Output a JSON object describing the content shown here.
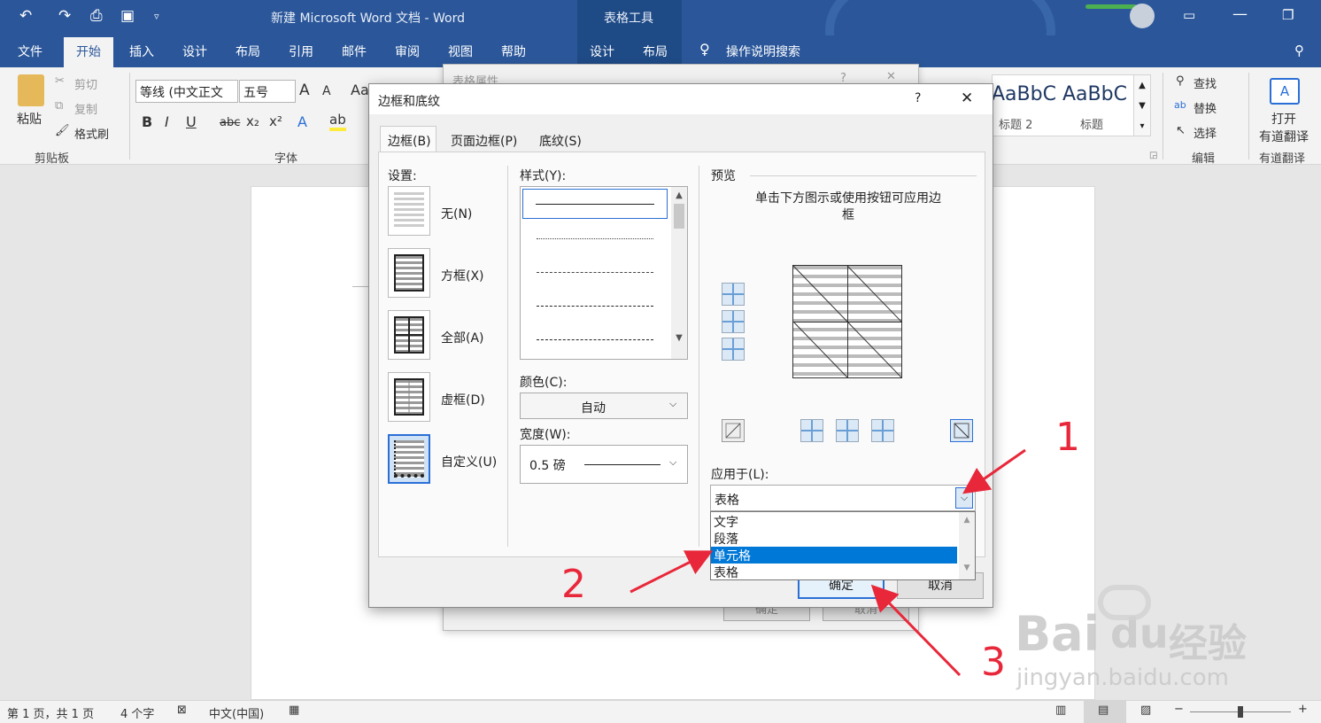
{
  "window": {
    "title": "新建 Microsoft Word 文档  -  Word",
    "context_tab": "表格工具"
  },
  "ribbon_tabs": [
    "文件",
    "开始",
    "插入",
    "设计",
    "布局",
    "引用",
    "邮件",
    "审阅",
    "视图",
    "帮助",
    "设计",
    "布局"
  ],
  "tell_me": "操作说明搜索",
  "clipboard": {
    "paste": "粘贴",
    "cut": "剪切",
    "copy": "复制",
    "painter": "格式刷",
    "group": "剪贴板"
  },
  "font": {
    "name": "等线 (中文正文",
    "size": "五号",
    "group": "字体",
    "bold": "B",
    "italic": "I",
    "underline": "U",
    "strike": "abc",
    "sub": "x₂",
    "sup": "x²",
    "grow": "A",
    "shrink": "A",
    "aa": "Aa"
  },
  "styles": {
    "s1": "AaBbC",
    "s1_label": "标题 2",
    "s2": "AaBbC",
    "s2_label": "标题"
  },
  "editing": {
    "find": "查找",
    "replace": "替换",
    "select": "选择",
    "group": "编辑"
  },
  "youdao": {
    "open": "打开",
    "sub": "有道翻译",
    "group": "有道翻译"
  },
  "back_dialog": {
    "title": "表格属性"
  },
  "dialog": {
    "title": "边框和底纹",
    "help": "?",
    "close": "✕",
    "tabs": [
      "边框(B)",
      "页面边框(P)",
      "底纹(S)"
    ],
    "settings_label": "设置:",
    "settings": [
      "无(N)",
      "方框(X)",
      "全部(A)",
      "虚框(D)",
      "自定义(U)"
    ],
    "style_label": "样式(Y):",
    "color_label": "颜色(C):",
    "color_value": "自动",
    "width_label": "宽度(W):",
    "width_value": "0.5 磅",
    "preview_label": "预览",
    "preview_hint": "单击下方图示或使用按钮可应用边框",
    "apply_label": "应用于(L):",
    "apply_value": "表格",
    "apply_options": [
      "文字",
      "段落",
      "单元格",
      "表格"
    ],
    "ok": "确定",
    "cancel": "取消"
  },
  "status": {
    "page": "第 1 页，共 1 页",
    "words": "4 个字",
    "lang": "中文(中国)",
    "zoom_minus": "−",
    "zoom_plus": "+"
  },
  "annotations": [
    "1",
    "2",
    "3"
  ],
  "watermark": {
    "brand": "Bai",
    "du": "du",
    "jingyan": "经验",
    "url": "jingyan.baidu.com"
  }
}
